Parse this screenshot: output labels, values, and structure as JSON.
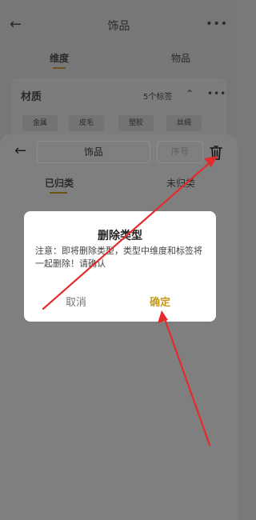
{
  "header": {
    "title": "饰品",
    "tabs": [
      "维度",
      "物品"
    ]
  },
  "category_card": {
    "title": "材质",
    "count_label": "5个标签",
    "chips": [
      "金属",
      "皮毛",
      "塑胶",
      "丝绸"
    ]
  },
  "sheet": {
    "name_value": "饰品",
    "order_placeholder": "序号",
    "tabs": [
      "已归类",
      "未归类"
    ]
  },
  "dialog": {
    "title": "删除类型",
    "message": "注意：即将删除类型，类型中维度和标签将一起删除！请确认",
    "cancel_label": "取消",
    "confirm_label": "确定"
  },
  "colors": {
    "accent": "#c59b1e",
    "annotation": "#e32b2b"
  }
}
